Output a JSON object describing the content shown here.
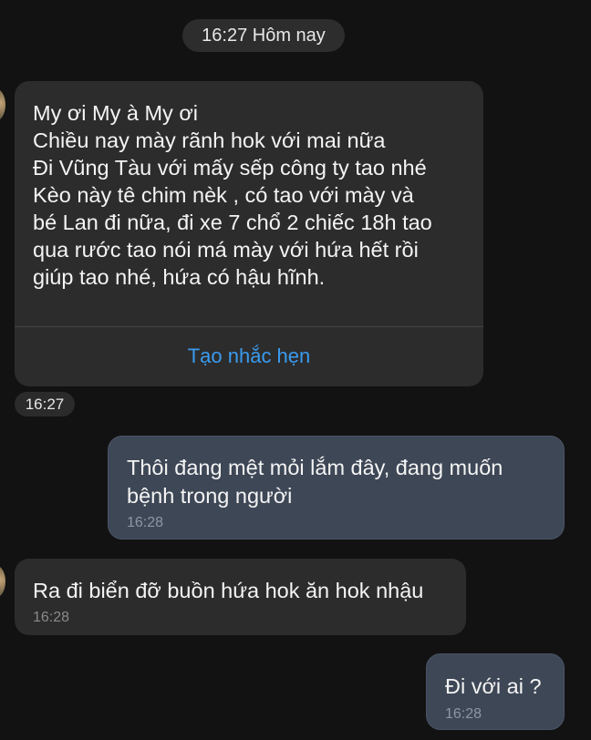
{
  "date_separator": "16:27 Hôm nay",
  "messages": [
    {
      "direction": "incoming",
      "lines": [
        "My ơi My à My ơi",
        "Chiều nay mày rãnh hok với mai nữa",
        "Đi Vũng Tàu với mấy sếp công ty tao nhé",
        "Kèo này tê chim nèk , có tao với mày và",
        "bé Lan đi nữa, đi xe 7 chổ 2 chiếc 18h tao",
        "qua rước tao nói má mày với hứa hết rồi",
        "giúp tao nhé, hứa có hậu hĩnh."
      ],
      "action_label": "Tạo nhắc hẹn",
      "time": "16:27"
    },
    {
      "direction": "outgoing",
      "lines": [
        "Thôi đang mệt mỏi lắm đây, đang muốn",
        "bệnh trong người"
      ],
      "time": "16:28"
    },
    {
      "direction": "incoming",
      "lines": [
        "Ra đi biển đỡ buồn hứa hok ăn hok nhậu"
      ],
      "time": "16:28"
    },
    {
      "direction": "outgoing",
      "lines": [
        "Đi với ai ?"
      ],
      "time": "16:28"
    }
  ],
  "colors": {
    "background": "#121212",
    "incoming_bubble": "#2c2c2c",
    "outgoing_bubble": "#3e4756",
    "action_link": "#3a9bf0"
  },
  "icons": {
    "sender_avatar": "avatar-photo"
  }
}
